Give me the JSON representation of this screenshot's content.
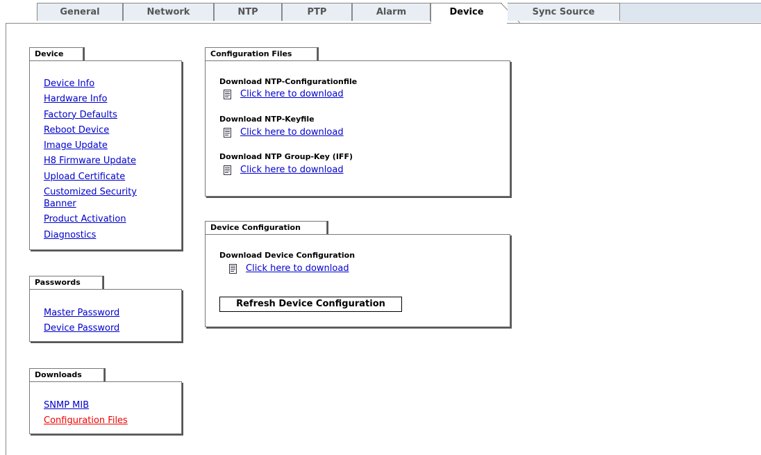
{
  "tabs": [
    "General",
    "Network",
    "NTP",
    "PTP",
    "Alarm",
    "Device",
    "Sync Source"
  ],
  "active_tab": "Device",
  "device_panel": {
    "label": "Device",
    "items": [
      "Device Info",
      "Hardware Info",
      "Factory Defaults",
      "Reboot Device",
      "Image Update",
      "H8 Firmware Update",
      "Upload Certificate",
      "Customized Security\nBanner",
      "Product Activation",
      "Diagnostics"
    ]
  },
  "passwords_panel": {
    "label": "Passwords",
    "items": [
      "Master Password",
      "Device Password"
    ]
  },
  "downloads_panel": {
    "label": "Downloads",
    "items": [
      "SNMP MIB",
      "Configuration Files"
    ]
  },
  "config_files_panel": {
    "label": "Configuration Files",
    "entries": [
      {
        "title": "Download NTP-Configurationfile",
        "link": "Click here to download"
      },
      {
        "title": "Download NTP-Keyfile",
        "link": "Click here to download"
      },
      {
        "title": "Download NTP Group-Key (IFF)",
        "link": "Click here to download"
      }
    ]
  },
  "device_config_panel": {
    "label": "Device Configuration",
    "entry": {
      "title": "Download Device Configuration",
      "link": "Click here to download"
    },
    "refresh_button": "Refresh Device Configuration"
  },
  "colors": {
    "link": "#0000cc",
    "visited_link": "#ee0000",
    "tab_bg": "#e8eef4"
  }
}
